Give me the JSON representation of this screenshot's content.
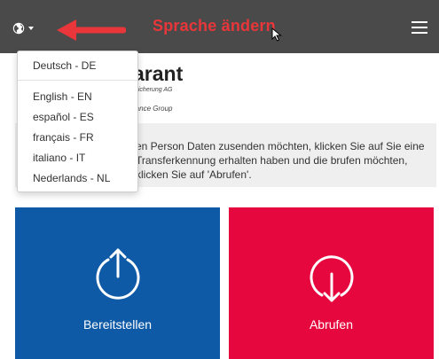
{
  "annotation": {
    "label": "Sprache ändern",
    "color": "#e8363a"
  },
  "topbar": {
    "globe_icon": "globe-icon",
    "menu_icon": "hamburger-menu-icon",
    "background": "#4a4a4a"
  },
  "language_menu": {
    "items": [
      {
        "label": "Deutsch - DE"
      },
      {
        "label": "English - EN"
      },
      {
        "label": "español - ES"
      },
      {
        "label": "français - FR"
      },
      {
        "label": "italiano - IT"
      },
      {
        "label": "Nederlands - NL"
      }
    ]
  },
  "logo": {
    "word": "arant",
    "sub1": "rsicherung AG",
    "sub2": "rance Group"
  },
  "info": {
    "text": "en Person Daten zusenden möchten, klicken Sie auf Sie eine Transferkennung erhalten haben und die brufen möchten, klicken Sie auf 'Abrufen'."
  },
  "tiles": {
    "provide": {
      "label": "Bereitstellen",
      "icon": "upload-circle-icon",
      "color": "#0e5aa7"
    },
    "retrieve": {
      "label": "Abrufen",
      "icon": "download-circle-icon",
      "color": "#e5073e"
    }
  }
}
